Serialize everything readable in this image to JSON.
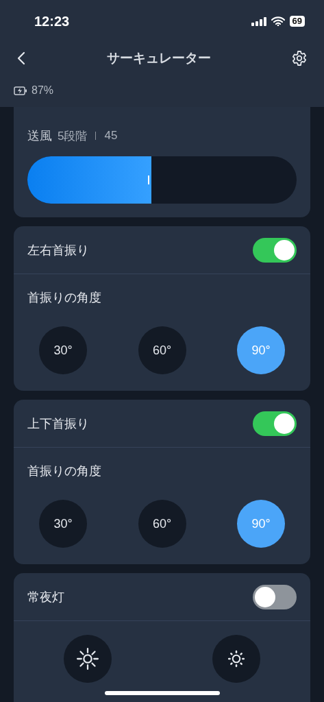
{
  "status_bar": {
    "time": "12:23",
    "battery": "69"
  },
  "header": {
    "title": "サーキュレーター",
    "battery_text": "87%"
  },
  "fan": {
    "label": "送風",
    "mode": "5段階",
    "value": "45",
    "level": 0.46
  },
  "sections": [
    {
      "kind": "swing",
      "title": "左右首振り",
      "on": true,
      "subtitle": "首振りの角度",
      "options": [
        {
          "label": "30°",
          "selected": false
        },
        {
          "label": "60°",
          "selected": false
        },
        {
          "label": "90°",
          "selected": true
        }
      ]
    },
    {
      "kind": "swing",
      "title": "上下首振り",
      "on": true,
      "subtitle": "首振りの角度",
      "options": [
        {
          "label": "30°",
          "selected": false
        },
        {
          "label": "60°",
          "selected": false
        },
        {
          "label": "90°",
          "selected": true
        }
      ]
    },
    {
      "kind": "light",
      "title": "常夜灯",
      "on": false,
      "buttons": [
        {
          "kind": "bright"
        },
        {
          "kind": "dim"
        }
      ]
    }
  ]
}
